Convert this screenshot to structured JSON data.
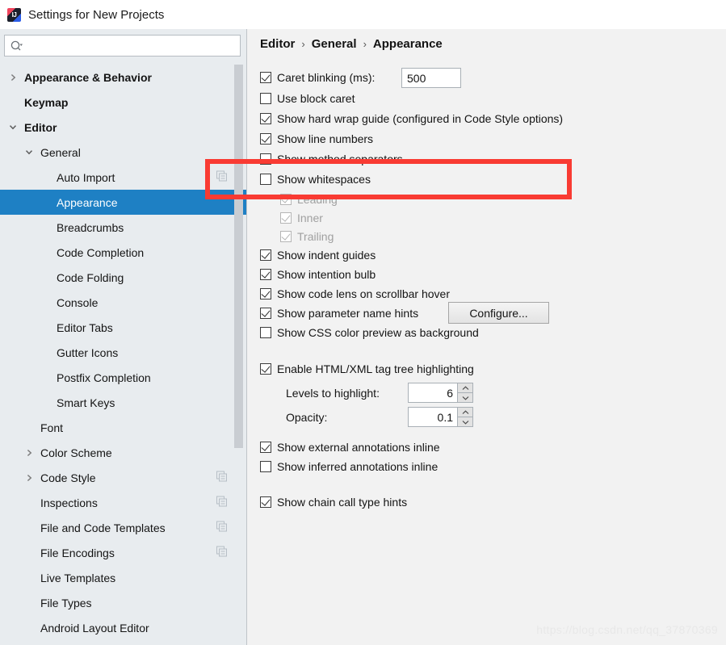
{
  "window": {
    "title": "Settings for New Projects",
    "logo_icon": "intellij-idea-logo"
  },
  "sidebar": {
    "search": {
      "value": "",
      "placeholder": "",
      "icon": "search-icon",
      "dropdown_icon": "chevron-down-icon"
    },
    "items": [
      {
        "label": "Appearance & Behavior",
        "indent": 0,
        "arrow": "chevron-right-icon",
        "bold": true,
        "selected": false,
        "badge": false
      },
      {
        "label": "Keymap",
        "indent": 0,
        "arrow": "",
        "bold": true,
        "selected": false,
        "badge": false
      },
      {
        "label": "Editor",
        "indent": 0,
        "arrow": "chevron-down-icon",
        "bold": true,
        "selected": false,
        "badge": false
      },
      {
        "label": "General",
        "indent": 1,
        "arrow": "chevron-down-icon",
        "bold": false,
        "selected": false,
        "badge": false
      },
      {
        "label": "Auto Import",
        "indent": 2,
        "arrow": "",
        "bold": false,
        "selected": false,
        "badge": true
      },
      {
        "label": "Appearance",
        "indent": 2,
        "arrow": "",
        "bold": false,
        "selected": true,
        "badge": false
      },
      {
        "label": "Breadcrumbs",
        "indent": 2,
        "arrow": "",
        "bold": false,
        "selected": false,
        "badge": false
      },
      {
        "label": "Code Completion",
        "indent": 2,
        "arrow": "",
        "bold": false,
        "selected": false,
        "badge": false
      },
      {
        "label": "Code Folding",
        "indent": 2,
        "arrow": "",
        "bold": false,
        "selected": false,
        "badge": false
      },
      {
        "label": "Console",
        "indent": 2,
        "arrow": "",
        "bold": false,
        "selected": false,
        "badge": false
      },
      {
        "label": "Editor Tabs",
        "indent": 2,
        "arrow": "",
        "bold": false,
        "selected": false,
        "badge": false
      },
      {
        "label": "Gutter Icons",
        "indent": 2,
        "arrow": "",
        "bold": false,
        "selected": false,
        "badge": false
      },
      {
        "label": "Postfix Completion",
        "indent": 2,
        "arrow": "",
        "bold": false,
        "selected": false,
        "badge": false
      },
      {
        "label": "Smart Keys",
        "indent": 2,
        "arrow": "",
        "bold": false,
        "selected": false,
        "badge": false
      },
      {
        "label": "Font",
        "indent": 1,
        "arrow": "",
        "bold": false,
        "selected": false,
        "badge": false
      },
      {
        "label": "Color Scheme",
        "indent": 1,
        "arrow": "chevron-right-icon",
        "bold": false,
        "selected": false,
        "badge": false
      },
      {
        "label": "Code Style",
        "indent": 1,
        "arrow": "chevron-right-icon",
        "bold": false,
        "selected": false,
        "badge": true
      },
      {
        "label": "Inspections",
        "indent": 1,
        "arrow": "",
        "bold": false,
        "selected": false,
        "badge": true
      },
      {
        "label": "File and Code Templates",
        "indent": 1,
        "arrow": "",
        "bold": false,
        "selected": false,
        "badge": true
      },
      {
        "label": "File Encodings",
        "indent": 1,
        "arrow": "",
        "bold": false,
        "selected": false,
        "badge": true
      },
      {
        "label": "Live Templates",
        "indent": 1,
        "arrow": "",
        "bold": false,
        "selected": false,
        "badge": false
      },
      {
        "label": "File Types",
        "indent": 1,
        "arrow": "",
        "bold": false,
        "selected": false,
        "badge": false
      },
      {
        "label": "Android Layout Editor",
        "indent": 1,
        "arrow": "",
        "bold": false,
        "selected": false,
        "badge": false
      }
    ]
  },
  "content": {
    "breadcrumb": {
      "part1": "Editor",
      "part2": "General",
      "part3": "Appearance",
      "separator": "›"
    },
    "caret_blinking": {
      "label": "Caret blinking (ms):",
      "checked": true,
      "value": "500"
    },
    "options": [
      {
        "label": "Use block caret",
        "checked": false
      },
      {
        "label": "Show hard wrap guide (configured in Code Style options)",
        "checked": true
      },
      {
        "label": "Show line numbers",
        "checked": true
      },
      {
        "label": "Show method separators",
        "checked": false
      },
      {
        "label": "Show whitespaces",
        "checked": false
      }
    ],
    "whitespace_suboptions": [
      {
        "label": "Leading",
        "checked": true,
        "disabled": true
      },
      {
        "label": "Inner",
        "checked": true,
        "disabled": true
      },
      {
        "label": "Trailing",
        "checked": true,
        "disabled": true
      }
    ],
    "options2": [
      {
        "label": "Show indent guides",
        "checked": true
      },
      {
        "label": "Show intention bulb",
        "checked": true
      },
      {
        "label": "Show code lens on scrollbar hover",
        "checked": true
      },
      {
        "label": "Show parameter name hints",
        "checked": true
      },
      {
        "label": "Show CSS color preview as background",
        "checked": false
      }
    ],
    "configure_button": "Configure...",
    "tag_tree": {
      "label": "Enable HTML/XML tag tree highlighting",
      "checked": true,
      "levels_label": "Levels to highlight:",
      "levels_value": "6",
      "opacity_label": "Opacity:",
      "opacity_value": "0.1"
    },
    "options3": [
      {
        "label": "Show external annotations inline",
        "checked": true
      },
      {
        "label": "Show inferred annotations inline",
        "checked": false
      }
    ],
    "options4": [
      {
        "label": "Show chain call type hints",
        "checked": true
      }
    ],
    "watermark": "https://blog.csdn.net/qq_37870369"
  },
  "colors": {
    "selection_blue": "#1e80c4",
    "sidebar_bg": "#e8ecef",
    "content_bg": "#f2f2f2",
    "annotation_red": "#f93b33"
  }
}
